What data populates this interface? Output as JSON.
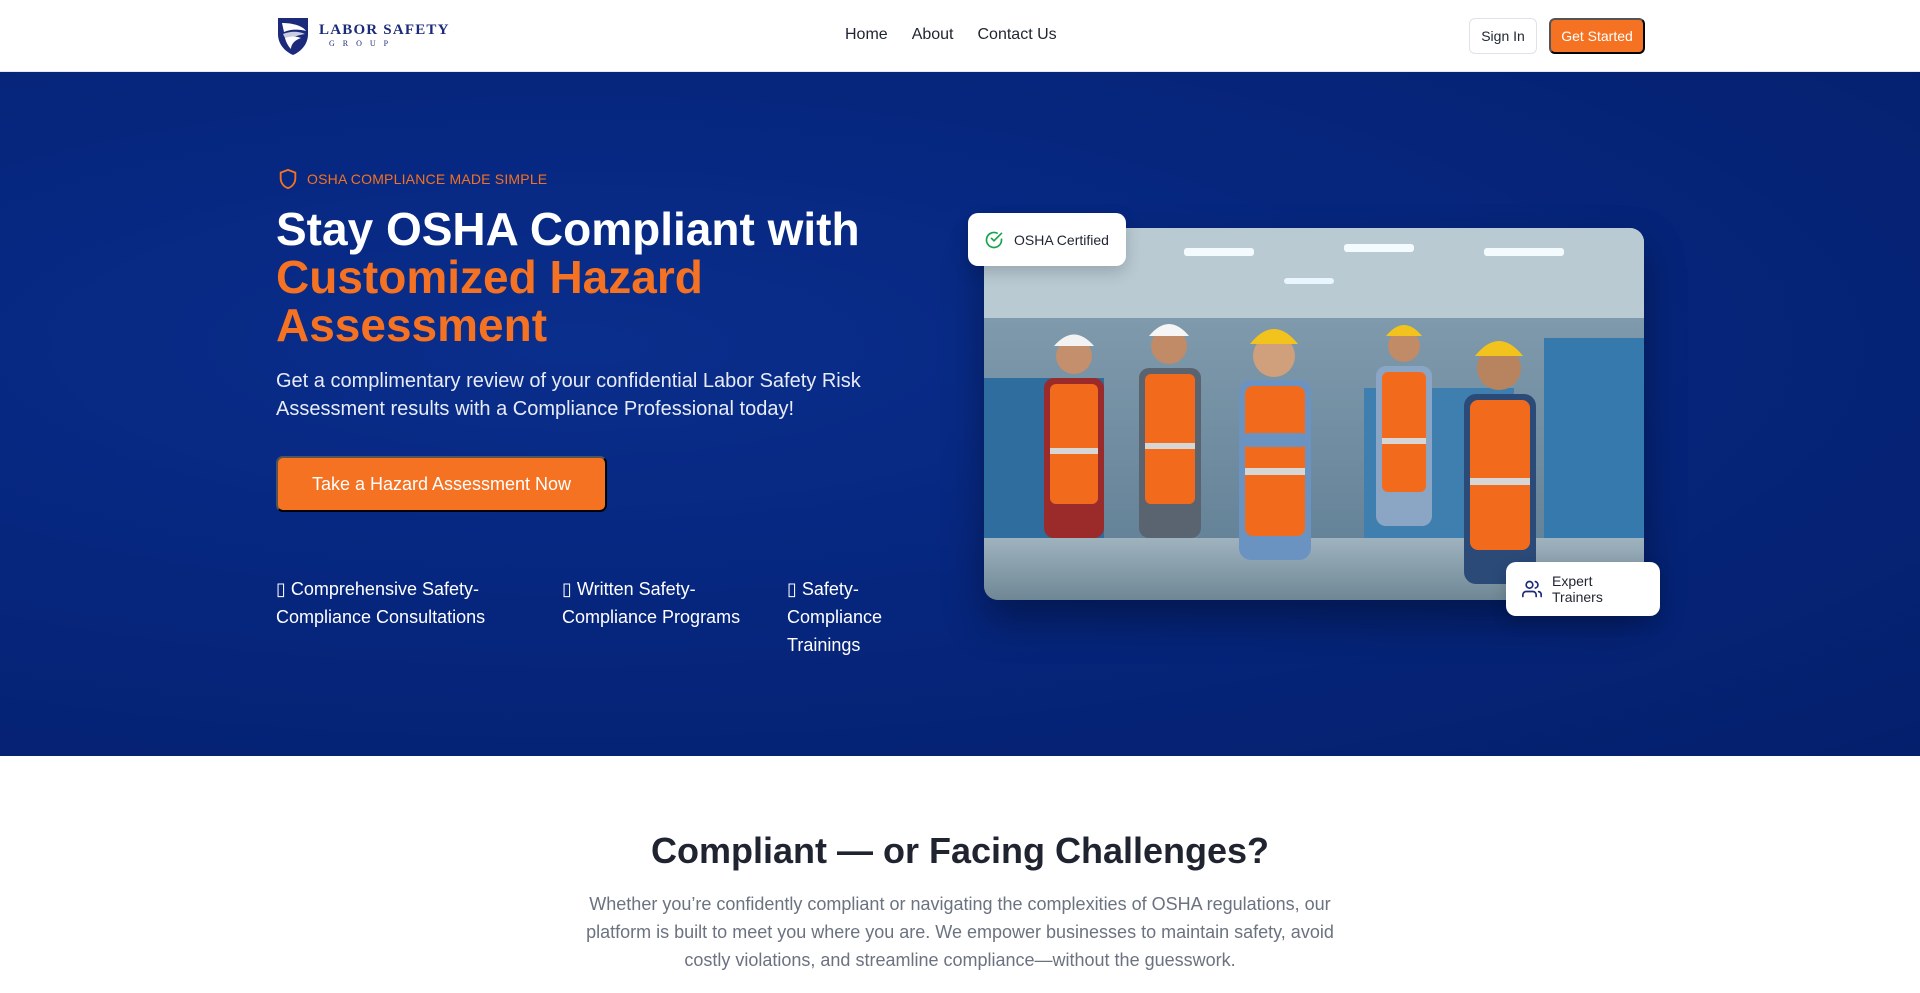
{
  "brand": {
    "name_main": "LABOR SAFETY",
    "name_sub": "GROUP"
  },
  "nav": {
    "links": [
      "Home",
      "About",
      "Contact Us"
    ],
    "signin_label": "Sign In",
    "start_label": "Get Started"
  },
  "hero": {
    "eyebrow": "OSHA COMPLIANCE MADE SIMPLE",
    "headline_plain": "Stay OSHA Compliant with",
    "headline_accent": "Customized Hazard Assessment",
    "subtext": "Get a complimentary review of your confidential Labor Safety Risk Assessment results with a Compliance Professional today!",
    "cta_label": "Take a Hazard Assessment Now",
    "features": [
      "▯ Comprehensive Safety-Compliance Consultations",
      "▯ Written Safety-Compliance Programs",
      "▯ Safety-Compliance Trainings"
    ],
    "badge_top": "OSHA Certified",
    "badge_bottom": "Expert Trainers"
  },
  "section2": {
    "title": "Compliant — or Facing Challenges?",
    "body": "Whether you’re confidently compliant or navigating the complexities of OSHA regulations, our platform is built to meet you where you are. We empower businesses to maintain safety, avoid costly violations, and streamline compliance—without the guesswork."
  },
  "colors": {
    "accent": "#f47221",
    "hero_bg": "#06267e",
    "brand_blue": "#1b2a7a"
  },
  "icons": {
    "eyebrow": "shield-icon",
    "badge_top": "check-circle-icon",
    "badge_bottom": "users-icon"
  }
}
